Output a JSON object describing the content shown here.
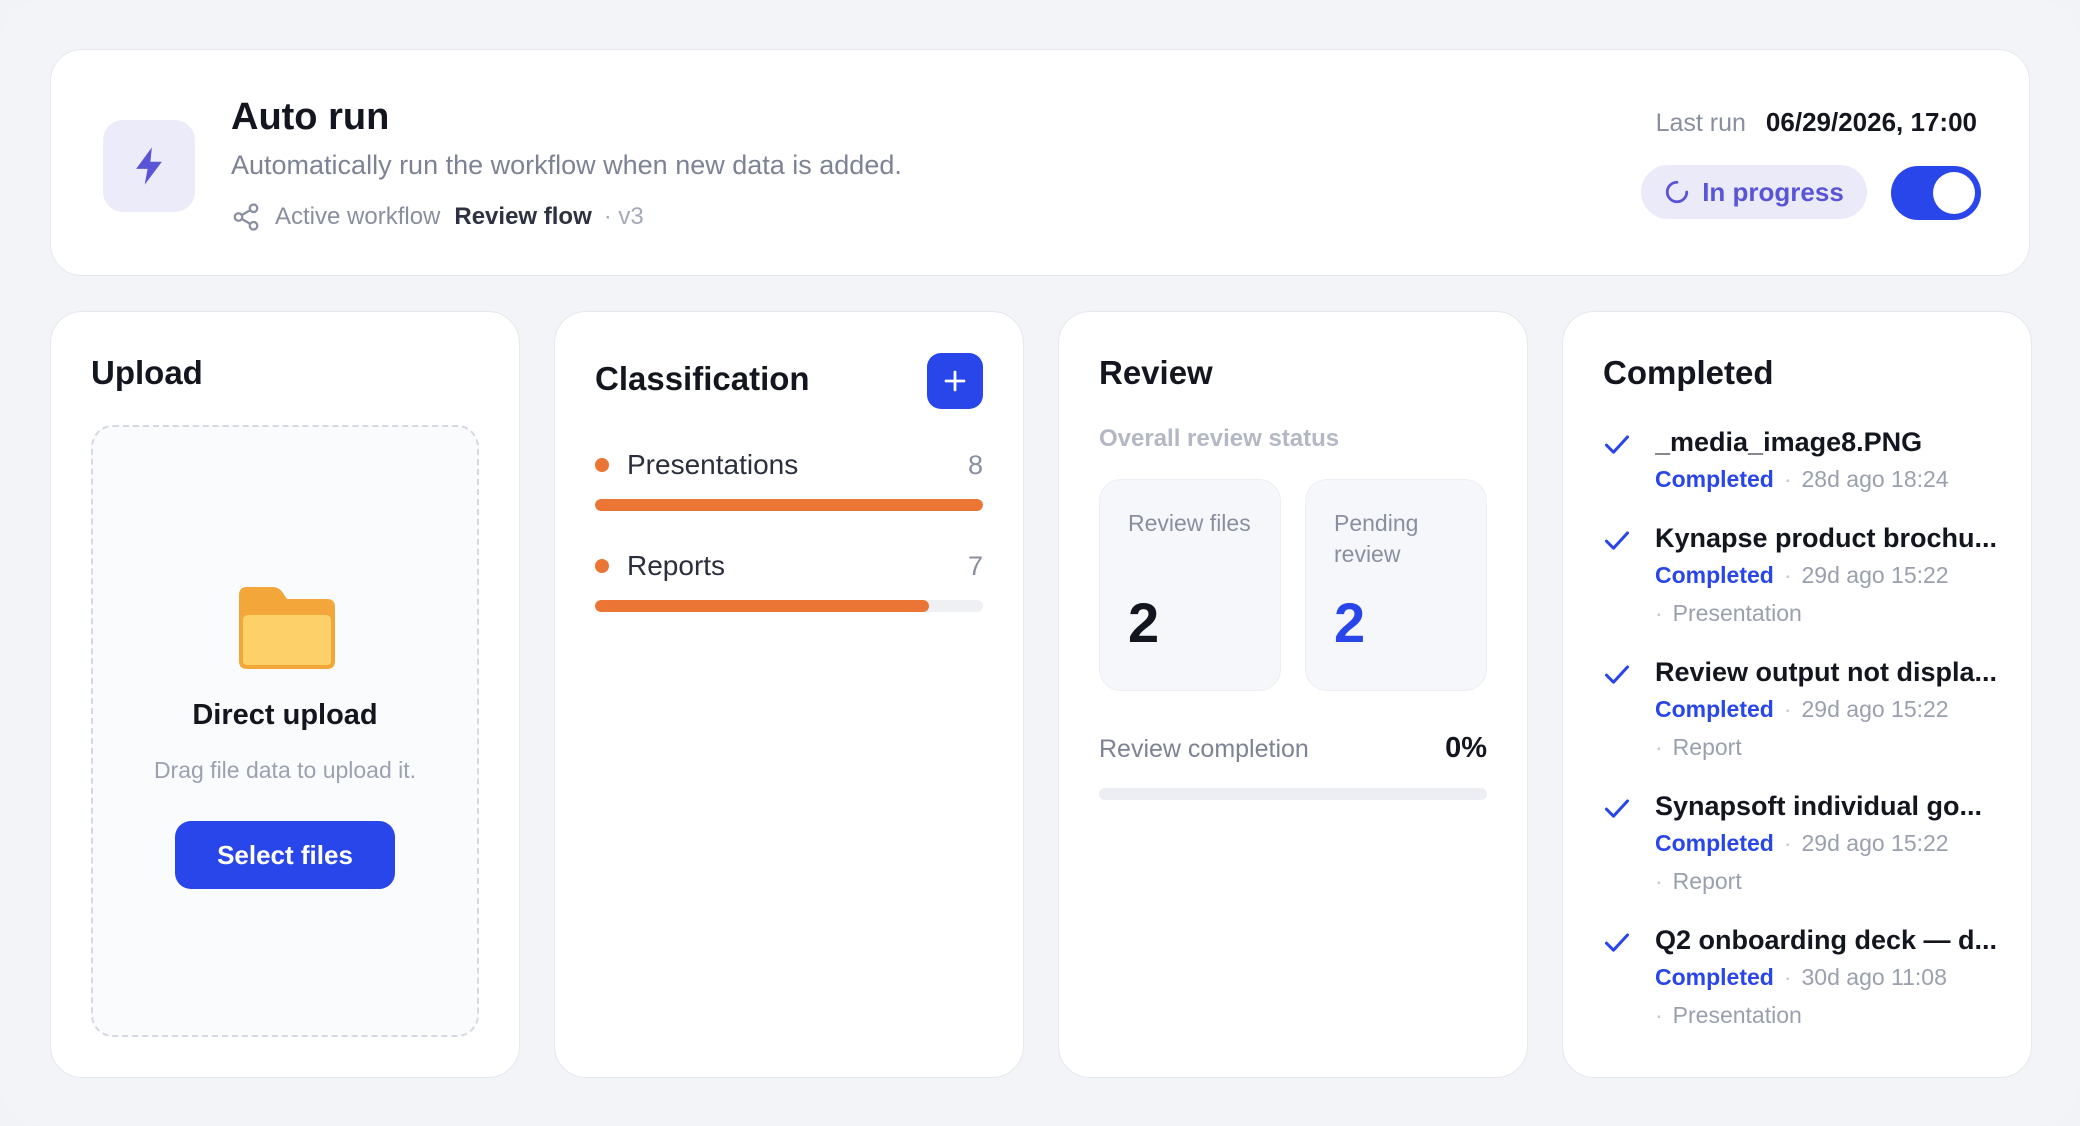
{
  "auto_run": {
    "title": "Auto run",
    "description": "Automatically run the workflow when new data is added.",
    "workflow_label": "Active workflow",
    "workflow_name": "Review flow",
    "workflow_version": "· v3",
    "last_run_label": "Last run",
    "last_run_value": "06/29/2026, 17:00",
    "status": "In progress",
    "toggle_on": true,
    "icon": "lightning-bolt-icon"
  },
  "upload": {
    "title": "Upload",
    "dropzone_title": "Direct upload",
    "dropzone_subtitle": "Drag file data to upload it.",
    "select_button": "Select files",
    "icon": "folder-icon"
  },
  "classification": {
    "title": "Classification",
    "items": [
      {
        "label": "Presentations",
        "count": "8",
        "fill_fraction": 1.0
      },
      {
        "label": "Reports",
        "count": "7",
        "fill_fraction": 0.86
      }
    ]
  },
  "review": {
    "title": "Review",
    "subtitle": "Overall review status",
    "stats": [
      {
        "label": "Review files",
        "value": "2"
      },
      {
        "label": "Pending review",
        "value": "2"
      }
    ],
    "completion_label": "Review completion",
    "completion_value": "0%",
    "completion_fraction": 0
  },
  "completed": {
    "title": "Completed",
    "items": [
      {
        "name": "_media_image8.PNG",
        "status": "Completed",
        "time": "28d ago 18:24",
        "type": ""
      },
      {
        "name": "Kynapse product brochu...",
        "status": "Completed",
        "time": "29d ago 15:22",
        "type": "Presentation"
      },
      {
        "name": "Review output not displa...",
        "status": "Completed",
        "time": "29d ago 15:22",
        "type": "Report"
      },
      {
        "name": "Synapsoft individual go...",
        "status": "Completed",
        "time": "29d ago 15:22",
        "type": "Report"
      },
      {
        "name": "Q2 onboarding deck — d...",
        "status": "Completed",
        "time": "30d ago 11:08",
        "type": "Presentation"
      }
    ]
  },
  "colors": {
    "accent": "#2846ea",
    "orange": "#ea7534",
    "purple": "#5a55d6"
  }
}
